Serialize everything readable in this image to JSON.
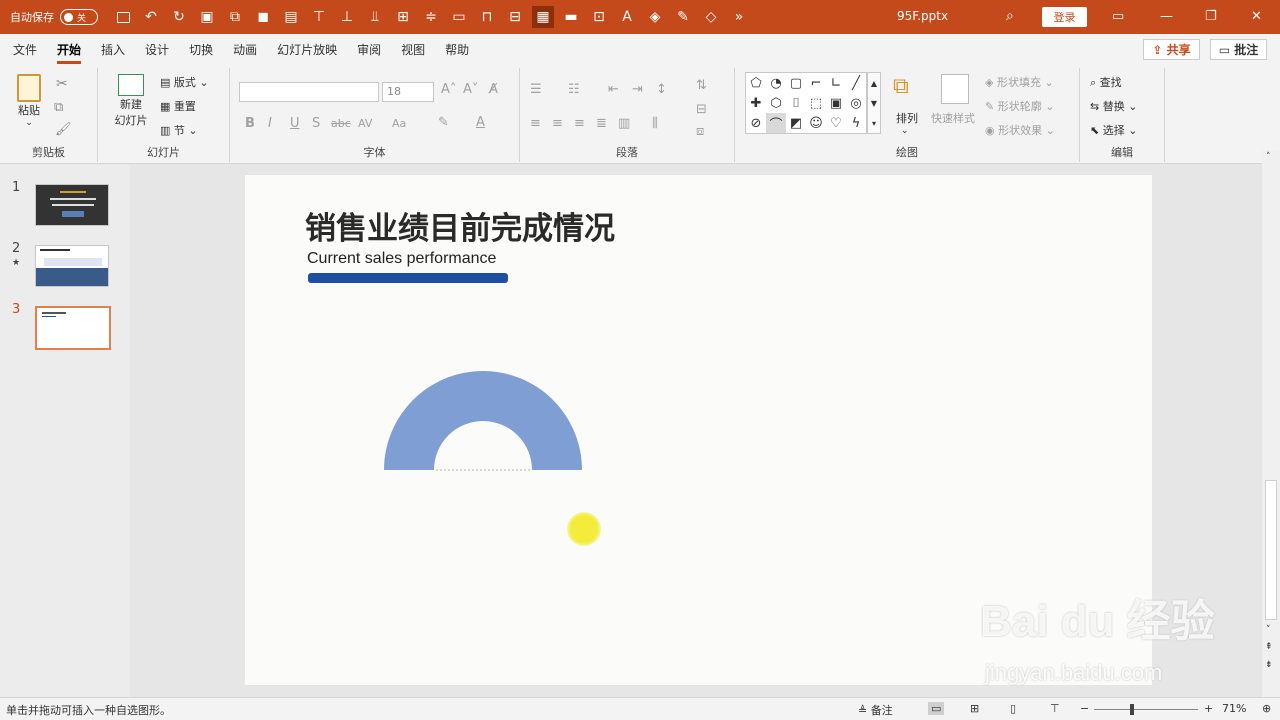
{
  "titlebar": {
    "autosave_label": "自动保存",
    "autosave_state": "关",
    "document_name": "95F.pptx",
    "login_label": "登录",
    "overflow_label": "»"
  },
  "ribbon_tabs": [
    "文件",
    "开始",
    "插入",
    "设计",
    "切换",
    "动画",
    "幻灯片放映",
    "审阅",
    "视图",
    "帮助"
  ],
  "active_tab": "开始",
  "share_label": "共享",
  "comment_label": "批注",
  "clipboard": {
    "paste_label": "粘贴",
    "group_label": "剪贴板"
  },
  "slides_group": {
    "new_slide_label": "新建\n幻灯片",
    "new_slide_line1": "新建",
    "new_slide_line2": "幻灯片",
    "layout_label": "版式",
    "reset_label": "重置",
    "section_label": "节",
    "group_label": "幻灯片"
  },
  "font_group": {
    "font_name": "",
    "font_size": "18",
    "bold": "B",
    "italic": "I",
    "underline": "U",
    "shadow": "S",
    "strike": "abc",
    "spacing": "AV",
    "case": "Aa",
    "group_label": "字体"
  },
  "paragraph_group": {
    "group_label": "段落"
  },
  "drawing_group": {
    "arrange_label": "排列",
    "quick_styles_label": "快速样式",
    "shape_fill_label": "形状填充",
    "shape_outline_label": "形状轮廓",
    "shape_effects_label": "形状效果",
    "group_label": "绘图"
  },
  "editing_group": {
    "find_label": "查找",
    "replace_label": "替换",
    "select_label": "选择",
    "group_label": "编辑"
  },
  "thumbnails": [
    {
      "number": "1"
    },
    {
      "number": "2",
      "star": "★"
    },
    {
      "number": "3"
    }
  ],
  "slide": {
    "title": "销售业绩目前完成情况",
    "subtitle": "Current sales performance",
    "shape_fill": "#7f9fd4",
    "bar_color": "#1f4fa0"
  },
  "statusbar": {
    "hint": "单击并拖动可插入一种自选图形。",
    "notes_label": "备注",
    "zoom": "71%"
  },
  "watermark": {
    "brand": "Bai du 经验",
    "url": "jingyan.baidu.com"
  },
  "colors": {
    "accent": "#c44a1c",
    "ribbon_bg": "#f3f3f3"
  }
}
